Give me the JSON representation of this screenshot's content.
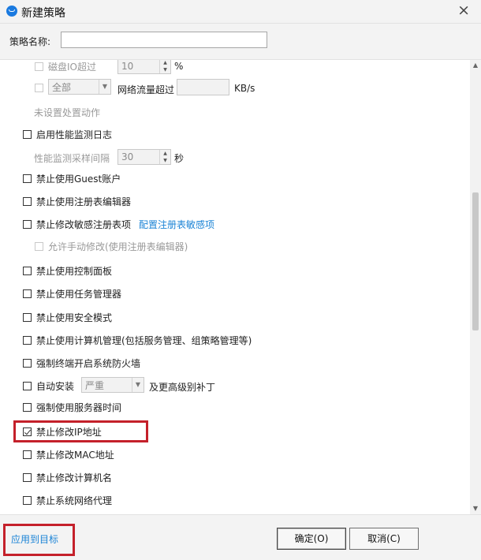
{
  "window": {
    "title": "新建策略",
    "close_icon": "×"
  },
  "name_field": {
    "label": "策略名称:",
    "value": ""
  },
  "policy": {
    "disk_io": {
      "label": "磁盘IO超过",
      "value": "10",
      "unit": "%"
    },
    "network": {
      "scope": "全部",
      "label": "网络流量超过",
      "value": "",
      "unit": "KB/s"
    },
    "no_action": "未设置处置动作",
    "perf_log": "启用性能监测日志",
    "sample_interval": {
      "label": "性能监测采样间隔",
      "value": "30",
      "unit": "秒"
    },
    "guest": "禁止使用Guest账户",
    "regedit": "禁止使用注册表编辑器",
    "reg_sensitive": "禁止修改敏感注册表项",
    "reg_sensitive_link": "配置注册表敏感项",
    "manual_modify": "允许手动修改(使用注册表编辑器)",
    "control_panel": "禁止使用控制面板",
    "task_manager": "禁止使用任务管理器",
    "safe_mode": "禁止使用安全模式",
    "computer_mgmt": "禁止使用计算机管理(包括服务管理、组策略管理等)",
    "firewall": "强制终端开启系统防火墙",
    "auto_install": {
      "label": "自动安装",
      "level": "严重",
      "suffix": "及更高级别补丁"
    },
    "time_server": "强制使用服务器时间",
    "ip": "禁止修改IP地址",
    "mac": "禁止修改MAC地址",
    "computer_name": "禁止修改计算机名",
    "proxy": "禁止系统网络代理"
  },
  "footer": {
    "apply_to_target": "应用到目标",
    "ok": "确定(O)",
    "cancel": "取消(C)"
  }
}
